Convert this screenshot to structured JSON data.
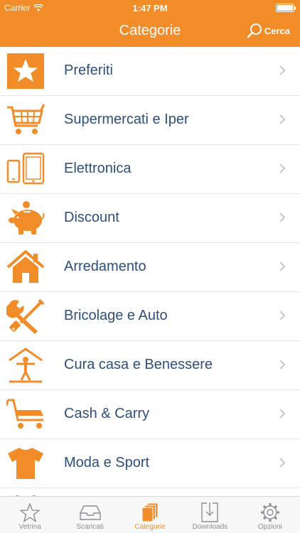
{
  "status": {
    "carrier": "Carrier",
    "time": "1:47 PM"
  },
  "nav": {
    "title": "Categorie",
    "search_label": "Cerca"
  },
  "colors": {
    "accent": "#f28c28",
    "label": "#2d4f7d",
    "tab_inactive": "#8e8e93"
  },
  "categories": [
    {
      "label": "Preferiti",
      "icon": "star-icon"
    },
    {
      "label": "Supermercati e Iper",
      "icon": "shopping-cart-icon"
    },
    {
      "label": "Elettronica",
      "icon": "devices-icon"
    },
    {
      "label": "Discount",
      "icon": "piggy-bank-icon"
    },
    {
      "label": "Arredamento",
      "icon": "house-icon"
    },
    {
      "label": "Bricolage e Auto",
      "icon": "tools-icon"
    },
    {
      "label": "Cura casa e Benessere",
      "icon": "person-home-icon"
    },
    {
      "label": "Cash & Carry",
      "icon": "trolley-icon"
    },
    {
      "label": "Moda e Sport",
      "icon": "tshirt-icon"
    }
  ],
  "tabs": [
    {
      "label": "Vetrina",
      "icon": "star-outline-icon",
      "active": false
    },
    {
      "label": "Scaricati",
      "icon": "inbox-icon",
      "active": false
    },
    {
      "label": "Categorie",
      "icon": "stack-icon",
      "active": true
    },
    {
      "label": "Downloads",
      "icon": "download-icon",
      "active": false
    },
    {
      "label": "Opzioni",
      "icon": "gear-icon",
      "active": false
    }
  ]
}
